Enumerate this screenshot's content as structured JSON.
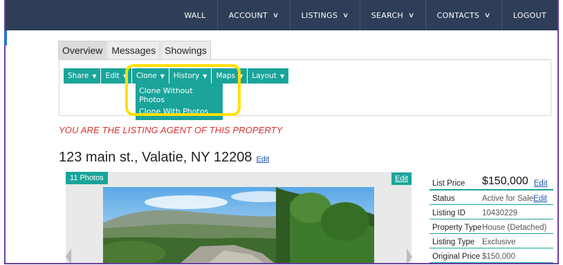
{
  "nav": {
    "items": [
      {
        "label": "WALL",
        "dropdown": false
      },
      {
        "label": "ACCOUNT",
        "dropdown": true
      },
      {
        "label": "LISTINGS",
        "dropdown": true
      },
      {
        "label": "SEARCH",
        "dropdown": true
      },
      {
        "label": "CONTACTS",
        "dropdown": true
      },
      {
        "label": "LOGOUT",
        "dropdown": false
      }
    ]
  },
  "tabs": [
    {
      "label": "Overview",
      "active": true
    },
    {
      "label": "Messages",
      "active": false
    },
    {
      "label": "Showings",
      "active": false
    }
  ],
  "toolbar": {
    "share": "Share",
    "edit": "Edit",
    "clone": "Clone",
    "history": "History",
    "maps": "Maps",
    "layout": "Layout"
  },
  "clone_menu": {
    "items": [
      "Clone Without Photos",
      "Clone With Photos"
    ]
  },
  "listing": {
    "agent_note": "YOU ARE THE LISTING AGENT OF THIS PROPERTY",
    "address": "123 main st., Valatie, NY 12208",
    "address_edit": "Edit",
    "photo_count": "11 Photos",
    "photo_edit": "Edit"
  },
  "details": {
    "list_price_label": "List Price",
    "list_price_value": "$150,000",
    "status_label": "Status",
    "status_value": "Active for Sale",
    "listing_id_label": "Listing ID",
    "listing_id_value": "10430229",
    "property_type_label": "Property Type",
    "property_type_value": "House (Detached)",
    "listing_type_label": "Listing Type",
    "listing_type_value": "Exclusive",
    "original_price_label": "Original Price",
    "original_price_value": "$150,000",
    "edit_label": "Edit"
  },
  "colors": {
    "nav_bg": "#2f3e58",
    "teal": "#1aa49a",
    "highlight": "#ffe000",
    "agent_red": "#d63030",
    "link": "#1a55b0"
  }
}
